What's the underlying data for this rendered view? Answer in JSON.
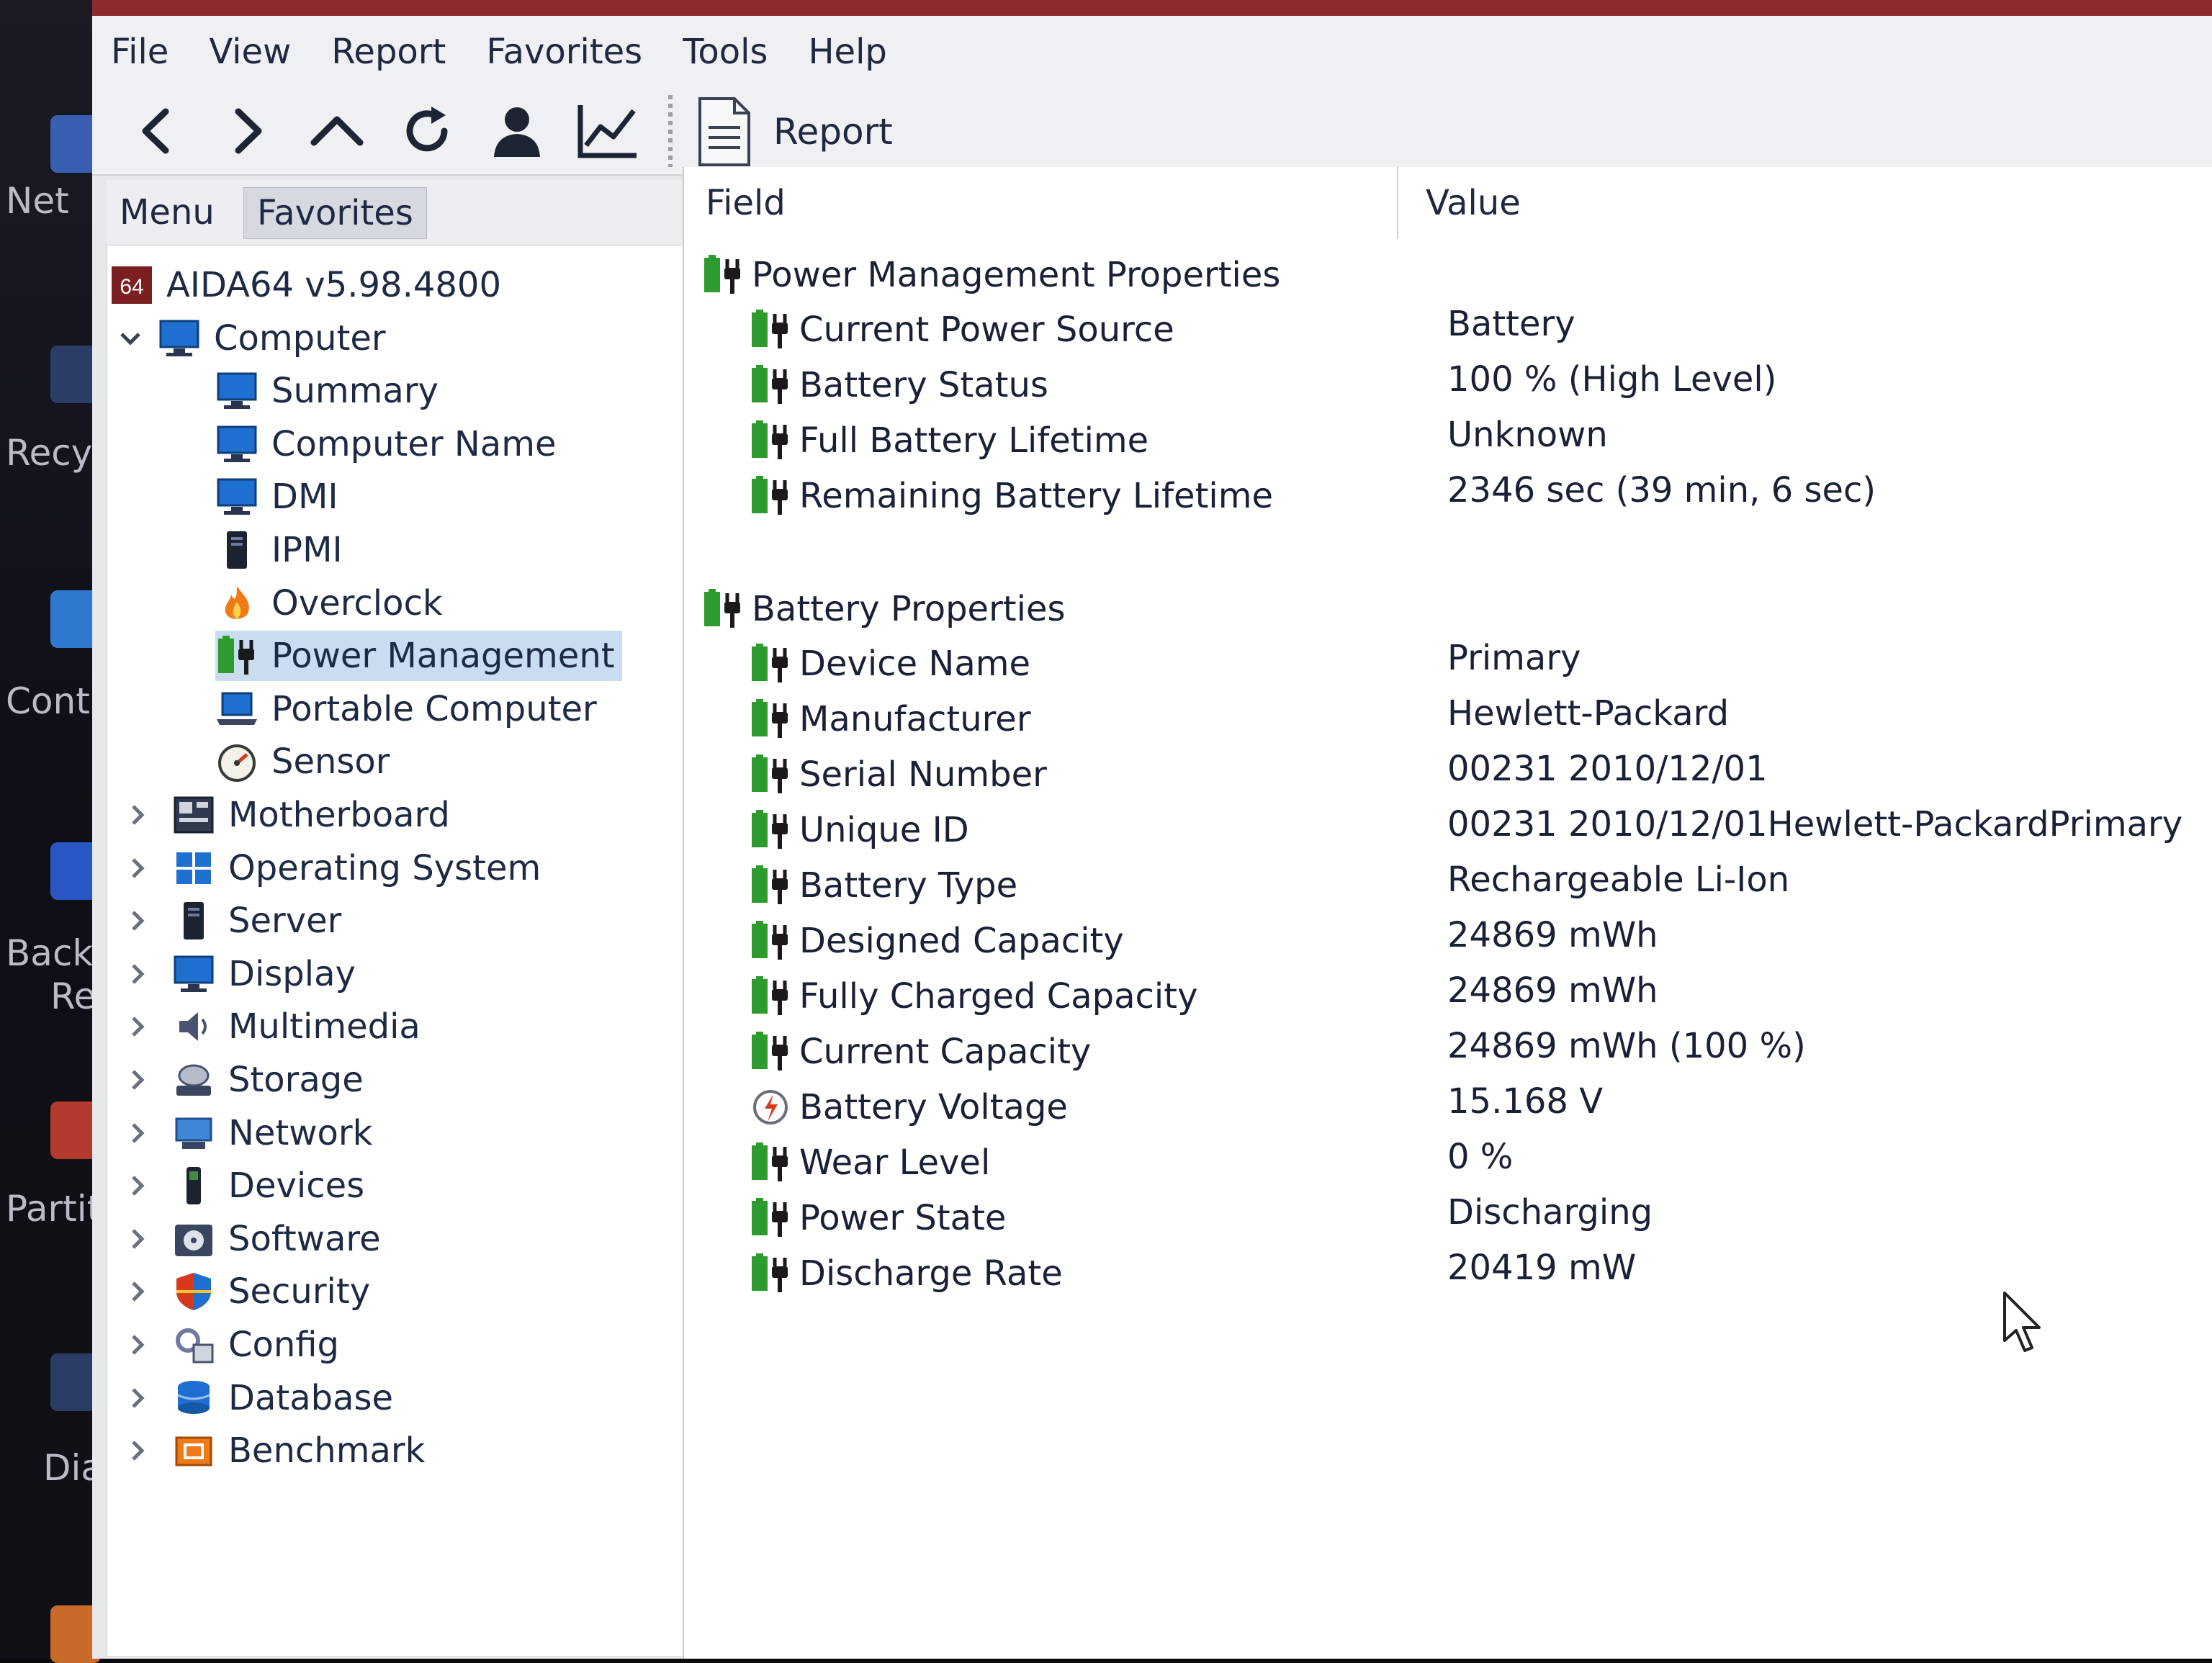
{
  "menubar": [
    "File",
    "View",
    "Report",
    "Favorites",
    "Tools",
    "Help"
  ],
  "toolbar": {
    "report_label": "Report"
  },
  "left_panel": {
    "tabs": [
      "Menu",
      "Favorites"
    ],
    "tree": [
      {
        "label": "AIDA64 v5.98.4800",
        "icon": "aida64-logo-icon"
      },
      {
        "label": "Computer",
        "icon": "computer-icon"
      },
      {
        "label": "Summary",
        "icon": "monitor-icon"
      },
      {
        "label": "Computer Name",
        "icon": "monitor-icon"
      },
      {
        "label": "DMI",
        "icon": "monitor-icon"
      },
      {
        "label": "IPMI",
        "icon": "server-tower-icon"
      },
      {
        "label": "Overclock",
        "icon": "flame-icon"
      },
      {
        "label": "Power Management",
        "icon": "battery-plug-icon"
      },
      {
        "label": "Portable Computer",
        "icon": "laptop-icon"
      },
      {
        "label": "Sensor",
        "icon": "gauge-icon"
      },
      {
        "label": "Motherboard",
        "icon": "motherboard-icon"
      },
      {
        "label": "Operating System",
        "icon": "windows-logo-icon"
      },
      {
        "label": "Server",
        "icon": "server-tower-icon"
      },
      {
        "label": "Display",
        "icon": "monitor-icon"
      },
      {
        "label": "Multimedia",
        "icon": "speaker-icon"
      },
      {
        "label": "Storage",
        "icon": "storage-disk-icon"
      },
      {
        "label": "Network",
        "icon": "network-icon"
      },
      {
        "label": "Devices",
        "icon": "device-icon"
      },
      {
        "label": "Software",
        "icon": "software-disc-icon"
      },
      {
        "label": "Security",
        "icon": "shield-icon"
      },
      {
        "label": "Config",
        "icon": "config-icon"
      },
      {
        "label": "Database",
        "icon": "database-icon"
      },
      {
        "label": "Benchmark",
        "icon": "benchmark-icon"
      }
    ]
  },
  "report": {
    "columns": [
      "Field",
      "Value"
    ],
    "sections": [
      {
        "title": "Power Management Properties",
        "rows": [
          {
            "field": "Current Power Source",
            "value": "Battery"
          },
          {
            "field": "Battery Status",
            "value": "100 % (High Level)"
          },
          {
            "field": "Full Battery Lifetime",
            "value": "Unknown"
          },
          {
            "field": "Remaining Battery Lifetime",
            "value": "2346 sec (39 min, 6 sec)"
          }
        ]
      },
      {
        "title": "Battery Properties",
        "rows": [
          {
            "field": "Device Name",
            "value": "Primary"
          },
          {
            "field": "Manufacturer",
            "value": "Hewlett-Packard"
          },
          {
            "field": "Serial Number",
            "value": "00231 2010/12/01"
          },
          {
            "field": "Unique ID",
            "value": "00231 2010/12/01Hewlett-PackardPrimary"
          },
          {
            "field": "Battery Type",
            "value": "Rechargeable Li-Ion"
          },
          {
            "field": "Designed Capacity",
            "value": "24869 mWh"
          },
          {
            "field": "Fully Charged Capacity",
            "value": "24869 mWh"
          },
          {
            "field": "Current Capacity",
            "value": "24869 mWh  (100 %)"
          },
          {
            "field": "Battery Voltage",
            "value": "15.168 V"
          },
          {
            "field": "Wear Level",
            "value": "0 %"
          },
          {
            "field": "Power State",
            "value": "Discharging"
          },
          {
            "field": "Discharge Rate",
            "value": "20419 mW"
          }
        ]
      }
    ]
  },
  "desktop": {
    "labels": [
      "Net",
      "Recy",
      "Contr",
      "Back",
      "Rec",
      "Partiti",
      "Diag"
    ]
  },
  "colors": {
    "battery_green": "#2e9b2e",
    "selection": "#c9dcf0",
    "title_strip": "#8b2a2f",
    "text": "#1e2a44"
  }
}
